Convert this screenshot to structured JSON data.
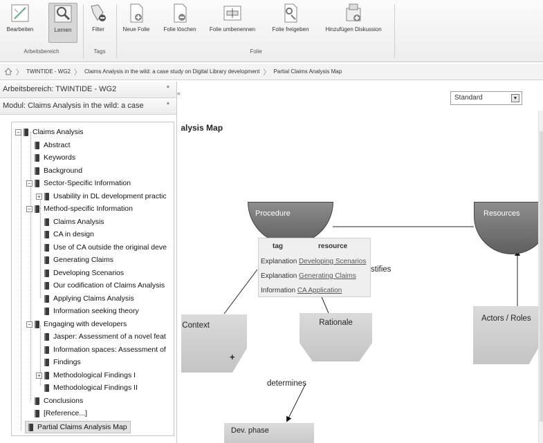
{
  "ribbon": {
    "buttons": [
      {
        "label": "Bearbeiten",
        "icon": "edit-icon"
      },
      {
        "label": "Lernen",
        "icon": "magnifier-icon"
      },
      {
        "label": "Filter",
        "icon": "filter-icon"
      },
      {
        "label": "Neue Folie",
        "icon": "new-slide-icon"
      },
      {
        "label": "Folie löschen",
        "icon": "delete-slide-icon"
      },
      {
        "label": "Folie umbenennen",
        "icon": "rename-slide-icon"
      },
      {
        "label": "Folie freigeben",
        "icon": "share-slide-icon"
      },
      {
        "label": "Hinzufügen Diskussion",
        "icon": "add-discussion-icon"
      }
    ],
    "groups": {
      "workspace": "Arbeitsbereich",
      "tags": "Tags",
      "slide": "Folie"
    }
  },
  "breadcrumb": {
    "items": [
      "TWINTIDE - WG2",
      "Claims Analysis in the wild: a case study on Digital Library development",
      "Partial Claims Analysis Map"
    ]
  },
  "sidebar": {
    "workspace": "Arbeitsbereich: TWINTIDE - WG2",
    "module": "Modul: Claims Analysis in the wild: a case",
    "star": "*",
    "tree": [
      "Claims Analysis",
      "Abstract",
      "Keywords",
      "Background",
      "Sector-Specific Information",
      "Usability in DL development practic",
      "Method-specific Information",
      "Claims Analysis",
      "CA in design",
      "Use of CA outside the original deve",
      "Generating Claims",
      "Developing Scenarios",
      "Our codification of Claims Analysis",
      "Applying Claims Analysis",
      "Information seeking theory",
      "Engaging with developers",
      "Jasper: Assessment of a novel feat",
      "Information spaces: Assessment of",
      "Findings",
      "Methodological Findings I",
      "Methodological Findings II",
      "Conclusions",
      "[Reference...]",
      "Partial Claims Analysis Map"
    ],
    "toggles": {
      "minus": "−",
      "plus": "+"
    }
  },
  "main": {
    "dropdown": "Standard",
    "dropdown_arrow": "▼",
    "collapse_arrow": "«",
    "title": "nalysis Map",
    "nodes": {
      "procedure": "Procedure",
      "resources": "Resources",
      "context": "v. Context",
      "context_plus": "+",
      "rationale": "Rationale",
      "actors": "Actors / Roles",
      "phase": "Dev. phase"
    },
    "edge_labels": {
      "justifies": "stifies",
      "determines": "determines"
    },
    "tooltip": {
      "header_tag": "tag",
      "header_resource": "resource",
      "rows": [
        {
          "tag": "Explanation",
          "resource": "Developing Scenarios"
        },
        {
          "tag": "Explanation",
          "resource": "Generating Claims"
        },
        {
          "tag": "Information",
          "resource": "CA Application"
        }
      ]
    }
  },
  "colors": {
    "node_dark": "#6e6e6e",
    "node_light": "#d0d0d0",
    "accent": "#555555"
  }
}
